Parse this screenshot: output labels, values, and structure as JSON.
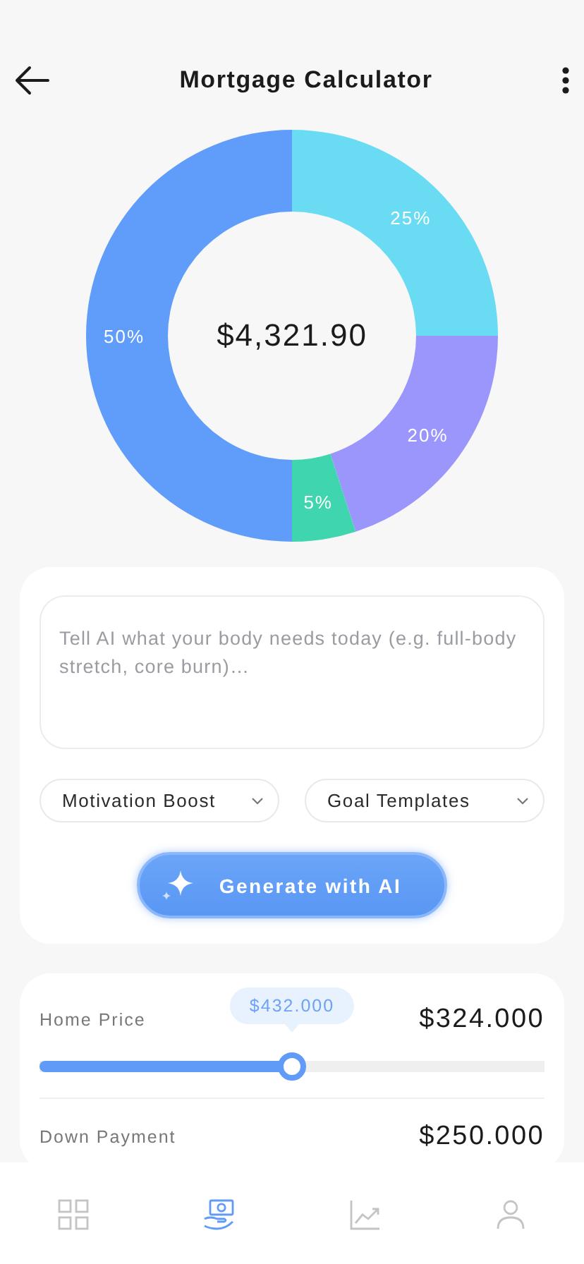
{
  "header": {
    "title": "Mortgage Calculator"
  },
  "payment_chart": {
    "center_label": "$4,321.90",
    "chart_data": {
      "type": "donut",
      "values": [
        25,
        20,
        5,
        50
      ],
      "colors": [
        "#69dcf4",
        "#9b96fc",
        "#3fd5ae",
        "#609dfb"
      ],
      "data_labels": true,
      "value_labels": [
        "25%",
        "20%",
        "5%",
        "50%"
      ]
    }
  },
  "ai_card": {
    "prompt": {
      "placeholder": "Tell AI what your body needs today (e.g. full-body stretch, core burn)…"
    },
    "dropdowns": [
      {
        "label": "Motivation Boost"
      },
      {
        "label": "Goal Templates"
      }
    ],
    "generate_button": "Generate with AI"
  },
  "sliders": [
    {
      "label": "Home Price",
      "value": "$324.000",
      "tooltip": "$432.000",
      "level": 0.5
    },
    {
      "label": "Down Payment",
      "value": "$250.000"
    }
  ],
  "bottom_nav": [
    {
      "selected": false
    },
    {
      "selected": true
    },
    {
      "selected": false
    },
    {
      "selected": false
    }
  ]
}
